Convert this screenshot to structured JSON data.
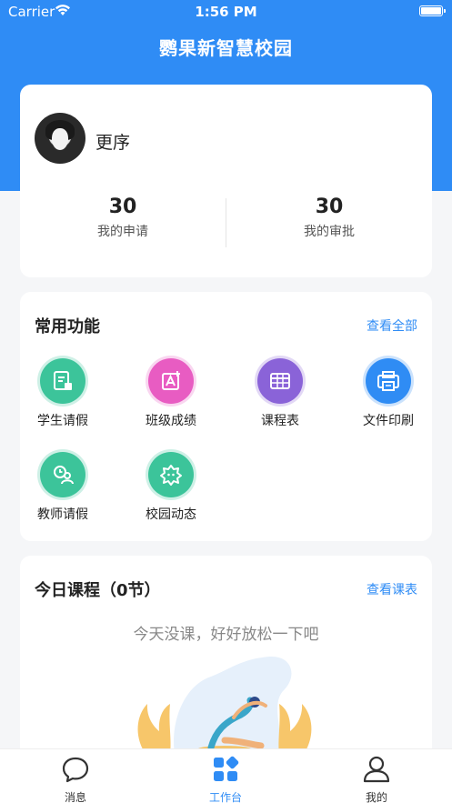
{
  "status_bar": {
    "carrier": "Carrier",
    "time": "1:56 PM"
  },
  "header": {
    "title": "鹦果新智慧校园"
  },
  "profile": {
    "name": "更序",
    "stats": [
      {
        "value": "30",
        "label": "我的申请"
      },
      {
        "value": "30",
        "label": "我的审批"
      }
    ]
  },
  "functions": {
    "title": "常用功能",
    "view_all": "查看全部",
    "items": [
      {
        "label": "学生请假",
        "icon": "leave-doc-icon",
        "color": "#3cc49a"
      },
      {
        "label": "班级成绩",
        "icon": "grade-icon",
        "color": "#e85cc2"
      },
      {
        "label": "课程表",
        "icon": "table-icon",
        "color": "#8a63d8"
      },
      {
        "label": "文件印刷",
        "icon": "printer-icon",
        "color": "#2f8cf5"
      },
      {
        "label": "教师请假",
        "icon": "teacher-leave-icon",
        "color": "#3cc49a"
      },
      {
        "label": "校园动态",
        "icon": "campus-news-icon",
        "color": "#3cc49a"
      }
    ]
  },
  "courses": {
    "title": "今日课程（0节）",
    "view_link": "查看课表",
    "empty_text": "今天没课，好好放松一下吧"
  },
  "tabs": [
    {
      "label": "消息",
      "icon": "chat-bubble-icon",
      "active": false
    },
    {
      "label": "工作台",
      "icon": "grid-apps-icon",
      "active": true
    },
    {
      "label": "我的",
      "icon": "person-icon",
      "active": false
    }
  ],
  "colors": {
    "primary": "#2f8cf5",
    "background": "#f5f6f8"
  }
}
